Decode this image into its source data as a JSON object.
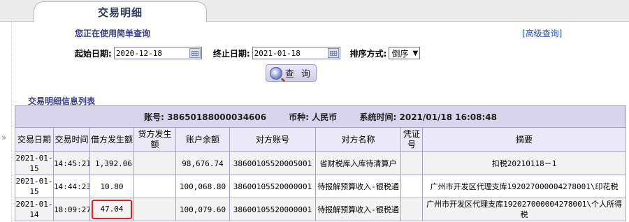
{
  "tab": {
    "title": "交易明细"
  },
  "query": {
    "subtitle": "您正在使用简单查询",
    "advanced_link": "[高级查询]",
    "start_label": "起始日期:",
    "start_value": "2020-12-18",
    "end_label": "终止日期:",
    "end_value": "2021-01-18",
    "sort_label": "排序方式:",
    "sort_value": "倒序",
    "search_button": "查 询"
  },
  "list": {
    "title": "交易明细信息列表",
    "account_label": "账号:",
    "account_value": "38650188000034606",
    "currency_label": "币种:",
    "currency_value": "人民币",
    "systime_label": "系统时间:",
    "systime_value": "2021/01/18 16:08:48",
    "columns": [
      "交易日期",
      "交易时间",
      "借方发生额",
      "贷方发生额",
      "账户余额",
      "对方账号",
      "对方名称",
      "凭证号",
      "摘要"
    ],
    "rows": [
      {
        "date": "2021-01-15",
        "time": "14:45:21",
        "debit": "1,392.06",
        "credit": "",
        "balance": "98,676.74",
        "counter_account": "38600105520005001",
        "counter_name": "省财税库入库待清算户",
        "voucher": "",
        "summary": "扣税20210118－1"
      },
      {
        "date": "2021-01-15",
        "time": "14:44:23",
        "debit": "10.80",
        "credit": "",
        "balance": "100,068.80",
        "counter_account": "38600105520000001",
        "counter_name": "待报解预算收入-银税通",
        "voucher": "",
        "summary": "广州市开发区代理支库192027000004278001\\印花税"
      },
      {
        "date": "2021-01-14",
        "time": "18:09:27",
        "debit": "47.04",
        "credit": "",
        "balance": "100,079.60",
        "counter_account": "38600105520000001",
        "counter_name": "待报解预算收入-银税通",
        "voucher": "",
        "summary": "广州市开发区代理支库192027000004278001\\个人所得税"
      }
    ]
  },
  "colors": {
    "accent": "#3d3d8f",
    "header_bg": "#d8d4ec",
    "highlight": "#e02020"
  }
}
